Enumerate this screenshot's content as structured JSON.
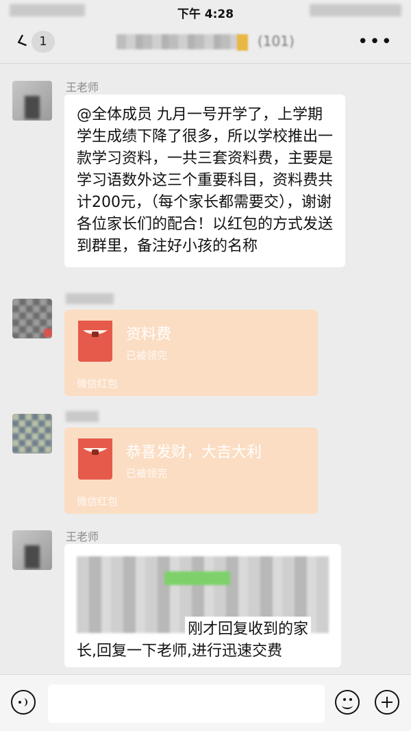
{
  "status_bar": {
    "time": "下午 4:28"
  },
  "nav": {
    "back_count": "1",
    "group_count": "(101)"
  },
  "messages": [
    {
      "sender": "王老师",
      "text": "@全体成员 九月一号开学了，上学期学生成绩下降了很多，所以学校推出一款学习资料，一共三套资料费，主要是学习语数外这三个重要科目，资料费共计200元，（每个家长都需要交），谢谢各位家长们的配合！以红包的方式发送到群里，备注好小孩的名称"
    },
    {
      "red_packet": {
        "title": "资料费",
        "status": "已被领完",
        "footer": "微信红包"
      }
    },
    {
      "red_packet": {
        "title": "恭喜发财，大吉大利",
        "status": "已被领完",
        "footer": "微信红包"
      }
    },
    {
      "sender": "王老师",
      "text_tail_line1": "刚才回复收到的家",
      "text_tail_line2": "长,回复一下老师,进行迅速交费"
    }
  ],
  "input": {
    "placeholder": ""
  },
  "icons": {
    "voice": "voice-icon",
    "emoji": "emoji-icon",
    "plus": "plus-icon",
    "back": "back-arrow-icon",
    "more": "more-icon"
  }
}
